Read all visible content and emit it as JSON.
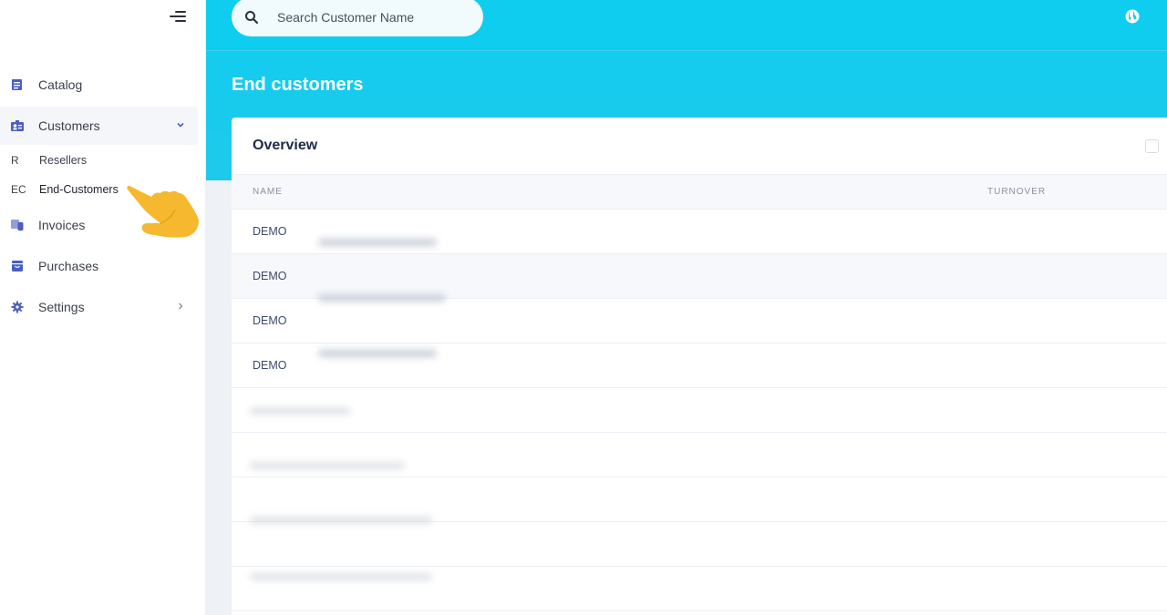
{
  "sidebar": {
    "items": [
      {
        "label": "Catalog",
        "icon": "catalog-icon"
      },
      {
        "label": "Customers",
        "icon": "customers-icon"
      },
      {
        "label": "Invoices",
        "icon": "invoices-icon"
      },
      {
        "label": "Purchases",
        "icon": "purchases-icon"
      },
      {
        "label": "Settings",
        "icon": "gear-icon"
      }
    ],
    "sub_items": [
      {
        "abbr": "R",
        "label": "Resellers"
      },
      {
        "abbr": "EC",
        "label": "End-Customers"
      }
    ]
  },
  "search": {
    "placeholder": "Search Customer Name"
  },
  "page": {
    "title": "End customers"
  },
  "card": {
    "title": "Overview",
    "columns": [
      "NAME",
      "TURNOVER"
    ],
    "rows": [
      {
        "name": "DEMO"
      },
      {
        "name": "DEMO"
      },
      {
        "name": "DEMO"
      },
      {
        "name": "DEMO"
      }
    ]
  },
  "colors": {
    "accent": "#0fcdee",
    "nav_icon": "#4a5fc1",
    "pointer": "#f5b82e"
  }
}
